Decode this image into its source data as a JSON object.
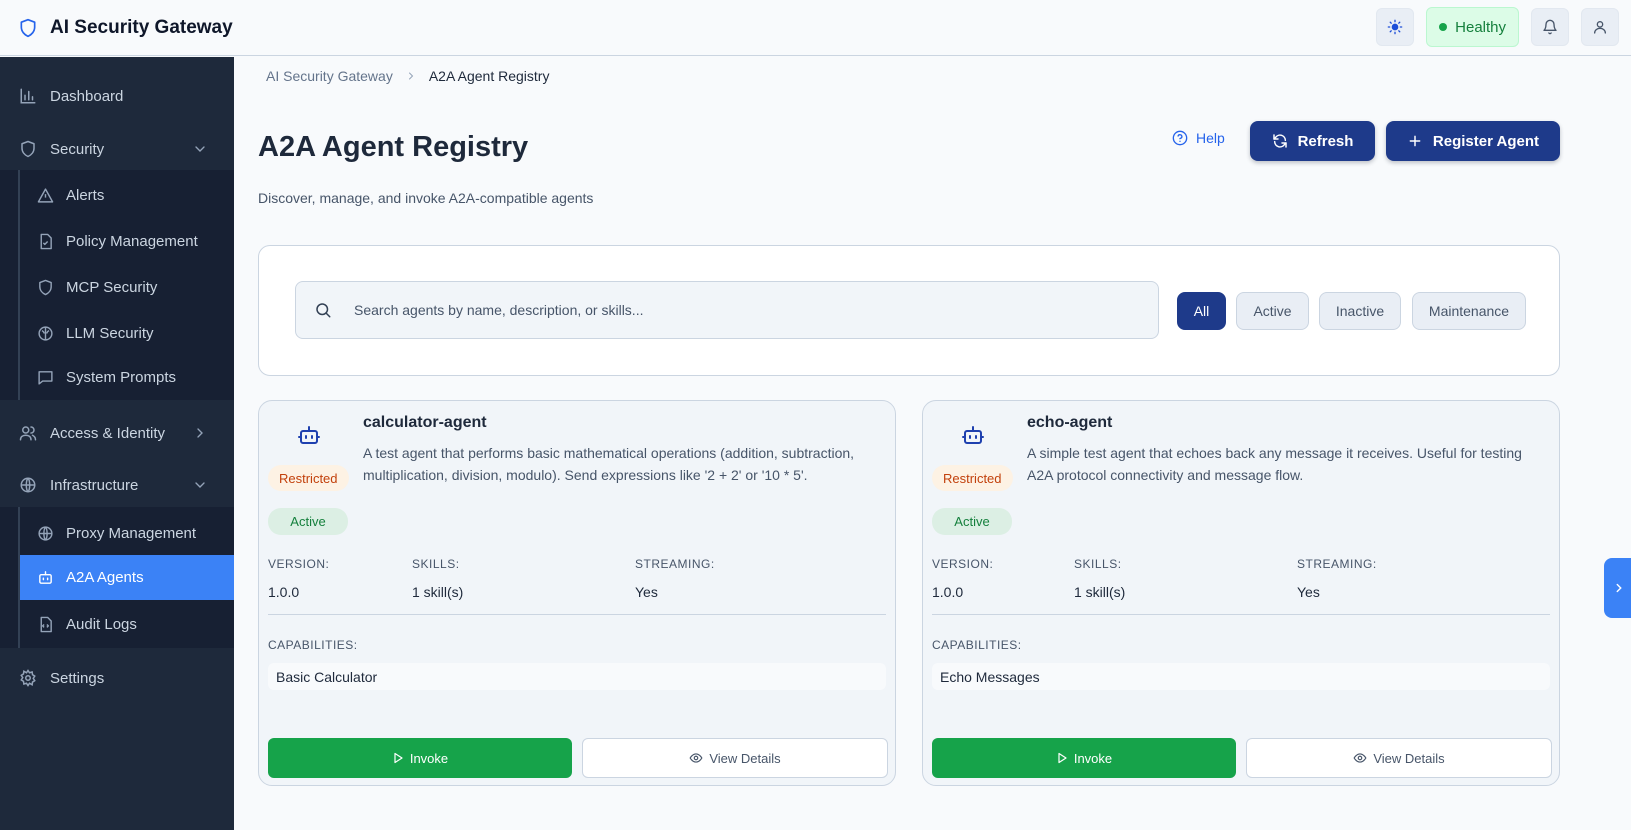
{
  "app": {
    "title": "AI Security Gateway"
  },
  "header": {
    "health_status": "Healthy"
  },
  "sidebar": {
    "dashboard": "Dashboard",
    "security": "Security",
    "security_items": [
      "Alerts",
      "Policy Management",
      "MCP Security",
      "LLM Security",
      "System Prompts"
    ],
    "access_identity": "Access & Identity",
    "infrastructure": "Infrastructure",
    "infrastructure_items": [
      "Proxy Management",
      "A2A Agents",
      "Audit Logs"
    ],
    "settings": "Settings"
  },
  "breadcrumb": [
    "AI Security Gateway",
    "A2A Agent Registry"
  ],
  "page": {
    "title": "A2A Agent Registry",
    "subtitle": "Discover, manage, and invoke A2A-compatible agents",
    "help_label": "Help",
    "refresh_label": "Refresh",
    "register_label": "Register Agent"
  },
  "search": {
    "placeholder": "Search agents by name, description, or skills..."
  },
  "filters": [
    "All",
    "Active",
    "Inactive",
    "Maintenance"
  ],
  "labels": {
    "version": "VERSION:",
    "skills": "SKILLS:",
    "streaming": "STREAMING:",
    "capabilities": "CAPABILITIES:",
    "invoke": "Invoke",
    "view_details": "View Details"
  },
  "agents": [
    {
      "name": "calculator-agent",
      "description": "A test agent that performs basic mathematical operations (addition, subtraction, multiplication, division, modulo). Send expressions like '2 + 2' or '10 * 5'.",
      "access": "Restricted",
      "status": "Active",
      "version": "1.0.0",
      "skills": "1 skill(s)",
      "streaming": "Yes",
      "capability": "Basic Calculator"
    },
    {
      "name": "echo-agent",
      "description": "A simple test agent that echoes back any message it receives. Useful for testing A2A protocol connectivity and message flow.",
      "access": "Restricted",
      "status": "Active",
      "version": "1.0.0",
      "skills": "1 skill(s)",
      "streaming": "Yes",
      "capability": "Echo Messages"
    }
  ]
}
